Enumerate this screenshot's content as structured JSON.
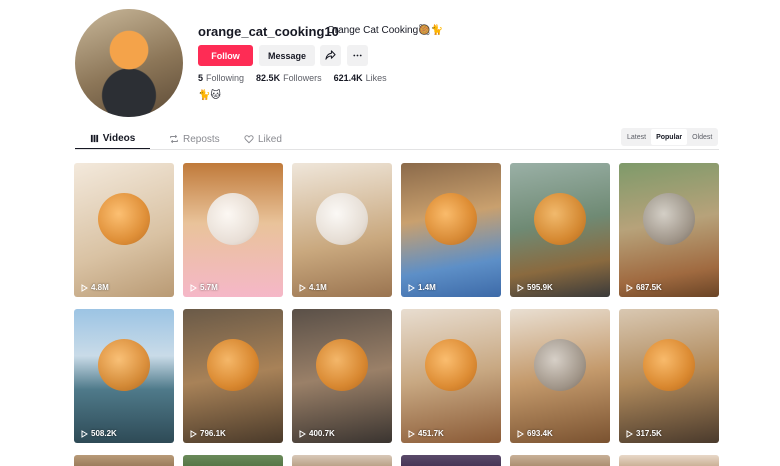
{
  "profile": {
    "username": "orange_cat_cooking10",
    "nickname": "Orange Cat Cooking🥘🐈",
    "follow_label": "Follow",
    "message_label": "Message",
    "following_count": "5",
    "following_label": "Following",
    "followers_count": "82.5K",
    "followers_label": "Followers",
    "likes_count": "621.4K",
    "likes_label": "Likes",
    "bio": "🐈🐱"
  },
  "tabs": [
    {
      "label": "Videos",
      "icon": "grid-icon",
      "active": true
    },
    {
      "label": "Reposts",
      "icon": "repost-icon",
      "active": false
    },
    {
      "label": "Liked",
      "icon": "heart-icon",
      "active": false
    }
  ],
  "sort": {
    "options": [
      "Latest",
      "Popular",
      "Oldest"
    ],
    "selected": "Popular"
  },
  "videos": [
    {
      "views": "4.8M"
    },
    {
      "views": "5.7M"
    },
    {
      "views": "4.1M"
    },
    {
      "views": "1.4M"
    },
    {
      "views": "595.9K"
    },
    {
      "views": "687.5K"
    },
    {
      "views": "508.2K"
    },
    {
      "views": "796.1K"
    },
    {
      "views": "400.7K"
    },
    {
      "views": "451.7K"
    },
    {
      "views": "693.4K"
    },
    {
      "views": "317.5K"
    }
  ],
  "colors": {
    "accent": "#fe2c55",
    "text": "#161823",
    "muted": "#8a8b91"
  }
}
